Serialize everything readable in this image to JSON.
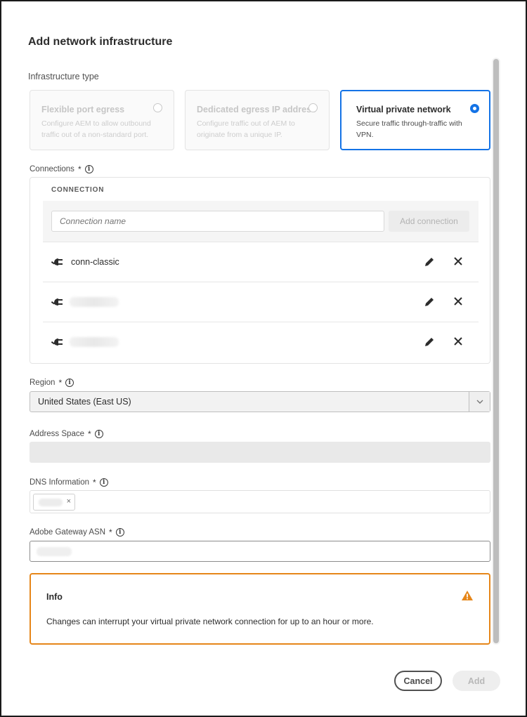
{
  "dialog": {
    "title": "Add network infrastructure"
  },
  "infrastructure": {
    "label": "Infrastructure type",
    "options": [
      {
        "title": "Flexible port egress",
        "description": "Configure AEM to allow outbound traffic out of a non-standard port.",
        "selected": false
      },
      {
        "title": "Dedicated egress IP address",
        "description": "Configure traffic out of AEM to originate from a unique IP.",
        "selected": false
      },
      {
        "title": "Virtual private network",
        "description": "Secure traffic through-traffic with VPN.",
        "selected": true
      }
    ]
  },
  "connections": {
    "label": "Connections",
    "required_marker": "*",
    "column_header": "CONNECTION",
    "input_placeholder": "Connection name",
    "add_label": "Add connection",
    "rows": [
      {
        "name": "conn-classic"
      },
      {
        "name": ""
      },
      {
        "name": ""
      }
    ]
  },
  "region": {
    "label": "Region",
    "required_marker": "*",
    "value": "United States (East US)"
  },
  "address_space": {
    "label": "Address Space",
    "required_marker": "*"
  },
  "dns": {
    "label": "DNS Information",
    "required_marker": "*",
    "tag_remove": "×"
  },
  "asn": {
    "label": "Adobe Gateway ASN",
    "required_marker": "*"
  },
  "alert": {
    "title": "Info",
    "message": "Changes can interrupt your virtual private network connection for up to an hour or more."
  },
  "footer": {
    "cancel_label": "Cancel",
    "add_label": "Add"
  },
  "colors": {
    "accent": "#1473e6",
    "warning": "#e68619"
  }
}
